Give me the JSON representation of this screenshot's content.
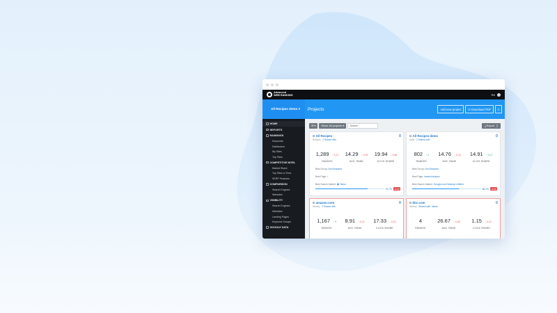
{
  "app": {
    "brand_line1": "Advanced",
    "brand_line2": "WEB RANKING",
    "project_selector": "All Recipes demo ▾",
    "page_title": "Projects",
    "header_buttons": [
      "Add new project",
      "⊡ Download PDF",
      "⚟"
    ]
  },
  "sidebar": {
    "items": [
      {
        "label": "HOME",
        "type": "section",
        "active": true
      },
      {
        "label": "REPORTS",
        "type": "section"
      },
      {
        "label": "RANKINGS",
        "type": "section"
      },
      {
        "label": "Keywords",
        "type": "sub"
      },
      {
        "label": "Distribution",
        "type": "sub"
      },
      {
        "label": "My Sites",
        "type": "sub"
      },
      {
        "label": "Top Sites",
        "type": "sub"
      },
      {
        "label": "COMPETITIVE INTEL",
        "type": "section"
      },
      {
        "label": "Market Share",
        "type": "sub"
      },
      {
        "label": "Top Sites in Time",
        "type": "sub"
      },
      {
        "label": "SERP Features",
        "type": "sub"
      },
      {
        "label": "COMPARISON",
        "type": "section"
      },
      {
        "label": "Search Engines",
        "type": "sub"
      },
      {
        "label": "Websites",
        "type": "sub"
      },
      {
        "label": "VISIBILITY",
        "type": "section"
      },
      {
        "label": "Search Engines",
        "type": "sub"
      },
      {
        "label": "Websites",
        "type": "sub"
      },
      {
        "label": "Landing Pages",
        "type": "sub"
      },
      {
        "label": "Keyword Groups",
        "type": "sub"
      },
      {
        "label": "GOOGLE DATA",
        "type": "section"
      }
    ]
  },
  "toolbar": {
    "view_toggle": "☰ ▾",
    "filter": "Show: All projects ▾",
    "search_placeholder": "Search",
    "export": "⤓ Export"
  },
  "cards": [
    {
      "title": "All Recipes",
      "meta_prefix": "Recipes",
      "meta_link": "2 Shared with",
      "metrics": [
        {
          "value": "1,289",
          "delta": "↓ 0.21",
          "dir": "down",
          "label": "RANKED"
        },
        {
          "value": "14.29",
          "delta": "↓ 0.05",
          "dir": "down",
          "label": "AVG. RANK"
        },
        {
          "value": "19.94",
          "delta": "↓ 0.56",
          "dir": "down",
          "label": "CLICK SHARE"
        }
      ],
      "rows": [
        {
          "label": "Best Group:",
          "value": "Non Branded"
        },
        {
          "label": "Best Page:",
          "value": "/"
        },
        {
          "label": "Best Search Market:",
          "value": "▣ Yahoo"
        }
      ],
      "progress": 0.76,
      "progress_text": "75.7%",
      "badge": "+1.05"
    },
    {
      "title": "All Recipes demo",
      "meta_prefix": "Daily",
      "meta_link": "2 Shared with",
      "metrics": [
        {
          "value": "802",
          "delta": "↑ 2",
          "dir": "up",
          "label": "RANKED"
        },
        {
          "value": "14.76",
          "delta": "↓ 0.13",
          "dir": "down",
          "label": "AVG. RANK"
        },
        {
          "value": "14.91",
          "delta": "↑ 0.17",
          "dir": "up",
          "label": "CLICK SHARE"
        }
      ],
      "rows": [
        {
          "label": "Best Group:",
          "value": "Non Branded"
        },
        {
          "label": "Best Page:",
          "value": "/search/recipes"
        },
        {
          "label": "Best Search Market:",
          "value": "Google.com Desktop Untitled"
        }
      ],
      "progress": 0.68,
      "progress_text": "68.2%",
      "badge": "+1.05"
    },
    {
      "title": "amazon.com",
      "meta_prefix": "Weekly",
      "meta_link": "2 Shared with",
      "metrics": [
        {
          "value": "1,167",
          "delta": "↑ 9",
          "dir": "up",
          "label": "RANKED"
        },
        {
          "value": "8.91",
          "delta": "↓ 0.21",
          "dir": "down",
          "label": "AVG. RANK"
        },
        {
          "value": "17.33",
          "delta": "↓ 0.01",
          "dir": "down",
          "label": "CLICK SHARE"
        }
      ],
      "rows": [],
      "short": true
    },
    {
      "title": "bbc.com",
      "meta_prefix": "Weekly",
      "meta_link": "Shared with: nfsmb",
      "metrics": [
        {
          "value": "4",
          "delta": "",
          "dir": "up",
          "label": "RANKED"
        },
        {
          "value": "26.67",
          "delta": "↓ 0.83",
          "dir": "down",
          "label": "AVG. RANK"
        },
        {
          "value": "1.15",
          "delta": "↓ 0.13",
          "dir": "down",
          "label": "CLICK SHARE"
        }
      ],
      "rows": [],
      "short": true
    }
  ]
}
